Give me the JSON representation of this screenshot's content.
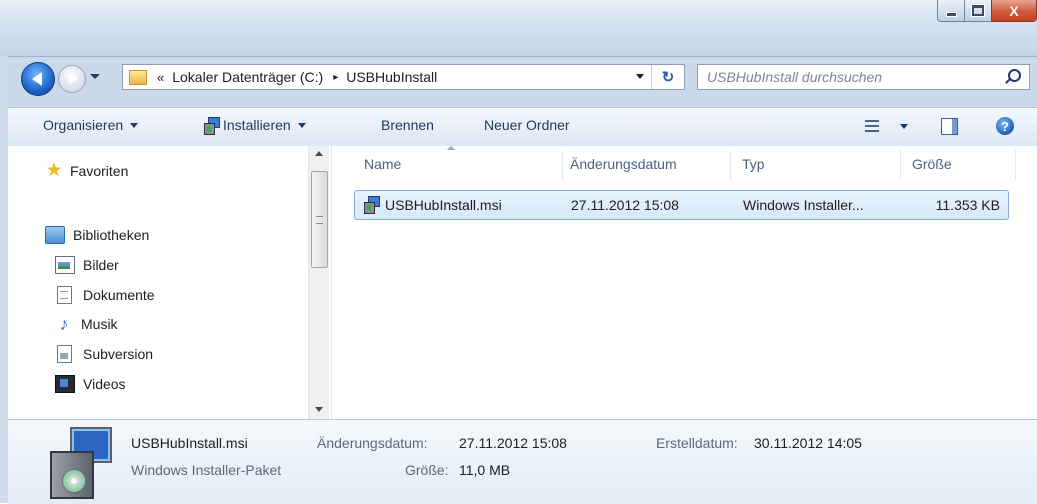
{
  "window": {
    "caption": {
      "minimize": "",
      "maximize": "",
      "close": "X"
    }
  },
  "address_bar": {
    "chevron": "«",
    "breadcrumbs": [
      "Lokaler Datenträger (C:)",
      "USBHubInstall"
    ],
    "separator": "▸",
    "refresh_glyph": "↻"
  },
  "search": {
    "placeholder": "USBHubInstall durchsuchen"
  },
  "toolbar": {
    "organize": "Organisieren",
    "install": "Installieren",
    "burn": "Brennen",
    "new_folder": "Neuer Ordner",
    "help": "?"
  },
  "nav": {
    "favorites": "Favoriten",
    "libraries": "Bibliotheken",
    "items": [
      "Bilder",
      "Dokumente",
      "Musik",
      "Subversion",
      "Videos"
    ]
  },
  "columns": [
    "Name",
    "Änderungsdatum",
    "Typ",
    "Größe"
  ],
  "files": [
    {
      "name": "USBHubInstall.msi",
      "modified": "27.11.2012 15:08",
      "type": "Windows Installer...",
      "size": "11.353 KB"
    }
  ],
  "details": {
    "name": "USBHubInstall.msi",
    "type": "Windows Installer-Paket",
    "modified_label": "Änderungsdatum:",
    "modified_value": "27.11.2012 15:08",
    "size_label": "Größe:",
    "size_value": "11,0 MB",
    "created_label": "Erstelldatum:",
    "created_value": "30.11.2012 14:05"
  },
  "colors": {
    "accent": "#2b66c2",
    "selection_border": "#84acdd",
    "toolbar_text": "#1e395b"
  },
  "icons": [
    "back-icon",
    "forward-icon",
    "folder-icon",
    "refresh-icon",
    "search-icon",
    "msi-icon",
    "views-icon",
    "preview-pane-icon",
    "help-icon",
    "star-icon",
    "library-icon",
    "pictures-icon",
    "document-icon",
    "music-icon",
    "subversion-icon",
    "videos-icon"
  ]
}
